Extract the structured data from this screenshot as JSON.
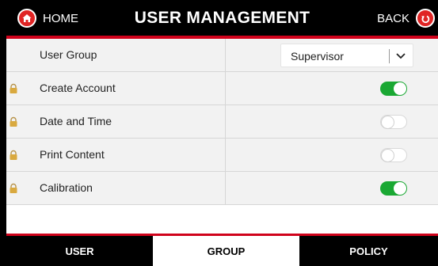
{
  "header": {
    "home_label": "HOME",
    "title": "USER MANAGEMENT",
    "back_label": "BACK"
  },
  "rows": [
    {
      "label": "User Group",
      "locked": false,
      "control": "select",
      "value": "Supervisor"
    },
    {
      "label": "Create Account",
      "locked": true,
      "control": "toggle",
      "on": true
    },
    {
      "label": "Date and Time",
      "locked": true,
      "control": "toggle",
      "on": false
    },
    {
      "label": "Print Content",
      "locked": true,
      "control": "toggle",
      "on": false
    },
    {
      "label": "Calibration",
      "locked": true,
      "control": "toggle",
      "on": true
    }
  ],
  "footer": {
    "tabs": [
      {
        "label": "USER",
        "active": false
      },
      {
        "label": "GROUP",
        "active": true
      },
      {
        "label": "POLICY",
        "active": false
      }
    ]
  },
  "colors": {
    "accent_red": "#d0021b",
    "toggle_on": "#1aa833",
    "row_bg": "#f2f2f2"
  }
}
